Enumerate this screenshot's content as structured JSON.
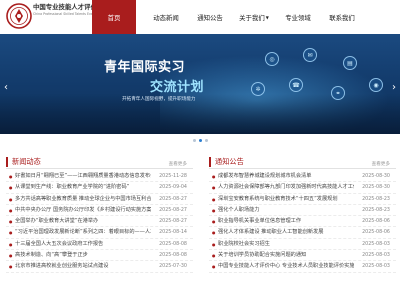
{
  "logo": {
    "cn": "中国专业技能人才评价中心",
    "en": "China Professional Skilled Talents Evaluation Center"
  },
  "nav": [
    {
      "label": "首页",
      "active": true
    },
    {
      "label": "动态新闻",
      "active": false
    },
    {
      "label": "通知公告",
      "active": false
    },
    {
      "label": "关于我们",
      "active": false
    },
    {
      "label": "专业领域",
      "active": false
    },
    {
      "label": "联系我们",
      "active": false
    }
  ],
  "banner": {
    "title1": "青年国际实习",
    "title2": "交流计划",
    "subtitle": "开拓青年人国际视野，提升职场能力",
    "prev": "‹",
    "next": "›"
  },
  "news": {
    "title": "新闻动态",
    "more": "查看更多",
    "items": [
      {
        "title": "好書如日月“翱翔已至”——江西翱翔质量香港动态信息发布会",
        "date": "2025-11-28"
      },
      {
        "title": "从课堂到生产线：职业教育产业学院的“进阶密码”",
        "date": "2025-09-04"
      },
      {
        "title": "多方共话高等职业教育质量 推动全球企业与中国市场互利合作",
        "date": "2025-08-27"
      },
      {
        "title": "中共中央办公厅 国务院办公厅印发《乡村建设行动实施方案》",
        "date": "2025-08-27"
      },
      {
        "title": "全国举办“职业教育大讲堂”在港举办",
        "date": "2025-08-27"
      },
      {
        "title": "“习近平治国理政发展新论断”系列之四：着眼目标的——人才工作",
        "date": "2025-08-14"
      },
      {
        "title": "十三届全国人大五次会议政府工作报告",
        "date": "2025-08-08"
      },
      {
        "title": "高技术制造、向“高”攀登于正步",
        "date": "2025-08-08"
      },
      {
        "title": "北京市推进高校就业创业服务站试点建设",
        "date": "2025-07-30"
      }
    ]
  },
  "notices": {
    "title": "通知公告",
    "more": "查看更多",
    "items": [
      {
        "title": "成都发布智慧养城建设规划城市机会清单",
        "date": "2025-08-30"
      },
      {
        "title": "人力资源社会保障部等九部门印发加强新时代高技能人才工作",
        "date": "2025-08-30"
      },
      {
        "title": "深圳宝安教育系统与职业教育技术“十四五”发展规划",
        "date": "2025-08-23"
      },
      {
        "title": "强化个人职场能力",
        "date": "2025-08-23"
      },
      {
        "title": "职业指导机关事业单位信息管理工作",
        "date": "2025-08-06"
      },
      {
        "title": "强化人才体系建设 推动职业人工智能创新发展",
        "date": "2025-08-06"
      },
      {
        "title": "职业院校社会实习招生",
        "date": "2025-08-03"
      },
      {
        "title": "关于培训学员协助配合实施问题的通知",
        "date": "2025-08-03"
      },
      {
        "title": "中国专业技能人才评价中心 专业技术人员职业技能评价实施指南",
        "date": "2025-08-03"
      }
    ]
  },
  "colors": {
    "brand": "#a91d1d",
    "banner_bg": "#133c6d"
  }
}
